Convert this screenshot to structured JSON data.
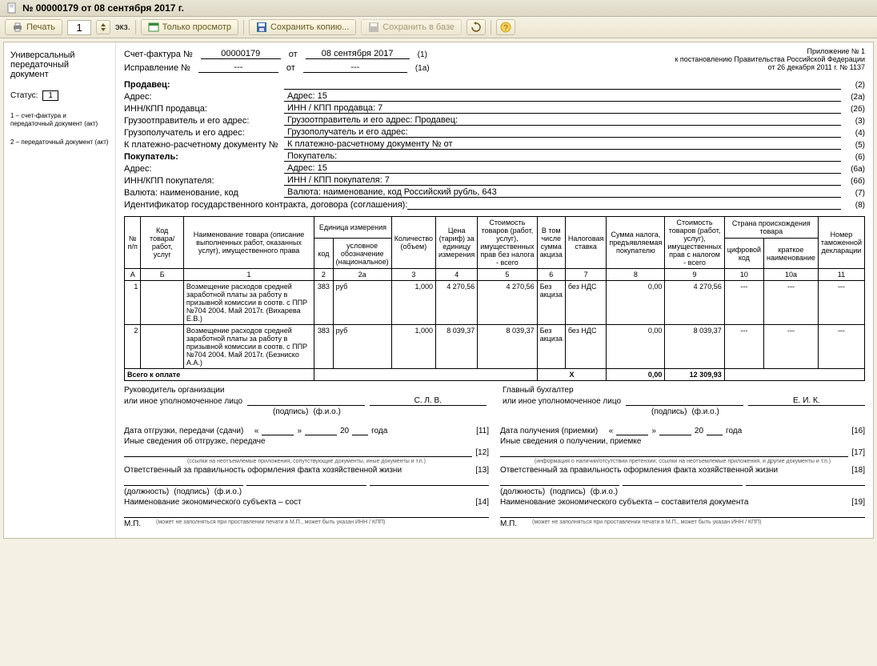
{
  "window": {
    "title": "№ 00000179 от 08 сентября 2017 г."
  },
  "toolbar": {
    "print": "Печать",
    "copies": "1",
    "copies_unit": "экз.",
    "view_only": "Только просмотр",
    "save_copy": "Сохранить копию...",
    "save_db": "Сохранить в базе"
  },
  "left": {
    "title1": "Универсальный",
    "title2": "передаточный",
    "title3": "документ",
    "status_label": "Статус:",
    "status_value": "1",
    "legend1": "1 – счет-фактура и передаточный документ (акт)",
    "legend2": "2 – передаточный документ (акт)"
  },
  "top_right": {
    "l1": "Приложение № 1",
    "l2": "к постановлению Правительства Российской Федерации",
    "l3": "от 26 декабря 2011 г. № 1137"
  },
  "header": {
    "invoice_no_label": "Счет-фактура №",
    "invoice_no": "00000179",
    "from_label": "от",
    "invoice_date": "08 сентября 2017",
    "p1": "(1)",
    "corr_label": "Исправление №",
    "corr_no": "---",
    "corr_date": "---",
    "p1a": "(1а)"
  },
  "fields": {
    "seller": {
      "label": "Продавец:",
      "val": "",
      "num": "(2)"
    },
    "addr": {
      "label": "Адрес:",
      "val": "Адрес: 15",
      "num": "(2а)"
    },
    "inn_seller": {
      "label": "ИНН/КПП продавца:",
      "val": "ИНН / КПП продавца: 7",
      "num": "(2б)"
    },
    "consignor": {
      "label": "Грузоотправитель и его адрес:",
      "val": "Грузоотправитель и его адрес: Продавец:",
      "num": "(3)"
    },
    "consignee": {
      "label": "Грузополучатель и его адрес:",
      "val": "Грузополучатель и его адрес:",
      "num": "(4)"
    },
    "payment": {
      "label": "К платежно-расчетному документу №",
      "val": "К платежно-расчетному документу №                           от",
      "num": "(5)"
    },
    "buyer": {
      "label": "Покупатель:",
      "val": "Покупатель:",
      "num": "(6)"
    },
    "buyer_addr": {
      "label": "Адрес:",
      "val": "Адрес: 15",
      "num": "(6а)"
    },
    "inn_buyer": {
      "label": "ИНН/КПП покупателя:",
      "val": "ИНН / КПП покупателя: 7",
      "num": "(6б)"
    },
    "currency": {
      "label": "Валюта: наименование, код",
      "val": "Валюта: наименование, код Российский рубль, 643",
      "num": "(7)"
    },
    "contract": {
      "label": "Идентификатор государственного контракта, договора (соглашения):",
      "val": "",
      "num": "(8)"
    }
  },
  "table": {
    "headers": {
      "npp": "№ п/п",
      "code": "Код товара/ работ, услуг",
      "name": "Наименование товара (описание выполненных работ, оказанных услуг), имущественного права",
      "unit": "Единица измерения",
      "unit_code": "код",
      "unit_name": "условное обозначение (национальное)",
      "qty": "Количество (объем)",
      "price": "Цена (тариф) за единицу измерения",
      "cost_no_tax": "Стоимость товаров (работ, услуг), имущественных прав без налога - всего",
      "excise": "В том числе сумма акциза",
      "rate": "Налоговая ставка",
      "tax": "Сумма налога, предъявляемая покупателю",
      "cost_with_tax": "Стоимость товаров (работ, услуг), имущественных прав с налогом - всего",
      "origin": "Страна происхождения товара",
      "origin_code": "цифровой код",
      "origin_name": "краткое наименование",
      "decl": "Номер таможенной декларации"
    },
    "colnums": [
      "А",
      "Б",
      "1",
      "2",
      "2а",
      "3",
      "4",
      "5",
      "6",
      "7",
      "8",
      "9",
      "10",
      "10а",
      "11"
    ],
    "rows": [
      {
        "n": "1",
        "code": "",
        "name": "Возмещение расходов средней заработной платы за работу в призывной комиссии в соотв. с ППР №704 2004. Май 2017г. (Вихарева Е.В.)",
        "ucode": "383",
        "uname": "руб",
        "qty": "1,000",
        "price": "4 270,56",
        "cost": "4 270,56",
        "excise": "Без акциза",
        "rate": "без НДС",
        "tax": "0,00",
        "total": "4 270,56",
        "oc": "---",
        "on": "---",
        "decl": "---"
      },
      {
        "n": "2",
        "code": "",
        "name": "Возмещение расходов средней заработной платы за работу в призывной комиссии в соотв. с ППР №704 2004. Май 2017г. (Безниско А.А.)",
        "ucode": "383",
        "uname": "руб",
        "qty": "1,000",
        "price": "8 039,37",
        "cost": "8 039,37",
        "excise": "Без акциза",
        "rate": "без НДС",
        "tax": "0,00",
        "total": "8 039,37",
        "oc": "---",
        "on": "---",
        "decl": "---"
      }
    ],
    "totals": {
      "label": "Всего к оплате",
      "x": "Х",
      "tax": "0,00",
      "total": "12 309,93"
    }
  },
  "sig": {
    "left_title": "Руководитель организации",
    "left_sub": "или иное уполномоченное лицо",
    "left_name": "С. Л. В.",
    "right_title": "Главный бухгалтер",
    "right_sub": "или иное уполномоченное лицо",
    "right_name": "Е. И. К.",
    "cap_sign": "(подпись)",
    "cap_fio": "(ф.и.о.)"
  },
  "lower": {
    "left": {
      "ship": "Дата отгрузки, передачи (сдачи)",
      "q": "«",
      "qe": "»",
      "y": "20",
      "ysuf": "года",
      "n11": "[11]",
      "other": "Иные сведения об отгрузке, передаче",
      "n12": "[12]",
      "note12": "(ссылки на неотъемлемые приложения, сопутствующие документы, иные документы и т.п.)",
      "resp": "Ответственный за правильность оформления факта хозяйственной жизни",
      "n13": "[13]",
      "cap_pos": "(должность)",
      "cap_sign": "(подпись)",
      "cap_fio": "(ф.и.о.)",
      "econ": "Наименование экономического субъекта – сост",
      "n14": "[14]",
      "mp_note": "(может не заполняться при проставлении печати в М.П., может быть указан ИНН / КПП)",
      "mp": "М.П."
    },
    "right": {
      "recv": "Дата получения (приемки)",
      "q": "«",
      "qe": "»",
      "y": "20",
      "ysuf": "года",
      "n16": "[16]",
      "other": "Иные сведения о получении, приемке",
      "n17": "[17]",
      "note17": "(информация о наличии/отсутствии претензии; ссылки на неотъемлемые приложения, и другие документы и т.п.)",
      "resp": "Ответственный за правильность оформления факта хозяйственной жизни",
      "n18": "[18]",
      "cap_pos": "(должность)",
      "cap_sign": "(подпись)",
      "cap_fio": "(ф.и.о.)",
      "econ": "Наименование экономического субъекта – составителя документа",
      "n19": "[19]",
      "mp_note": "(может не заполняться при проставлении печати в М.П., может быть указан ИНН / КПП)",
      "mp": "М.П."
    }
  }
}
